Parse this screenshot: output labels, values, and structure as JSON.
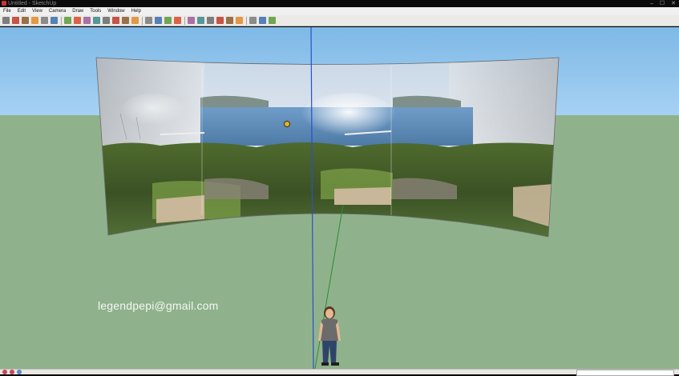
{
  "window": {
    "title": "Untitled - SketchUp",
    "controls": [
      "–",
      "☐",
      "✕"
    ]
  },
  "menu": [
    "File",
    "Edit",
    "View",
    "Camera",
    "Draw",
    "Tools",
    "Window",
    "Help"
  ],
  "toolbar": {
    "groups": [
      [
        "select-tool",
        "line-tool",
        "eraser-tool",
        "rectangle-tool",
        "circle-tool",
        "arc-tool"
      ],
      [
        "make-component-tool",
        "paint-bucket-tool",
        "push-pull-tool",
        "move-tool",
        "rotate-tool",
        "follow-me-tool",
        "scale-tool",
        "offset-tool"
      ],
      [
        "orbit-tool",
        "pan-tool",
        "zoom-tool",
        "zoom-extents-tool"
      ],
      [
        "warehouse-tool",
        "share-model-tool",
        "components-tool",
        "styles-tool",
        "layers-tool",
        "materials-tool"
      ],
      [
        "extension-tool",
        "photo-textures-tool",
        "export-tool"
      ]
    ],
    "accent": "#d94a2c"
  },
  "viewport": {
    "sky_color": "#8fc3ec",
    "ground_color": "#8fb28c"
  },
  "overlay": {
    "email": "legendpepi@gmail.com"
  },
  "statusbar": {
    "icons": [
      "info-icon",
      "user-icon",
      "geo-icon"
    ]
  }
}
